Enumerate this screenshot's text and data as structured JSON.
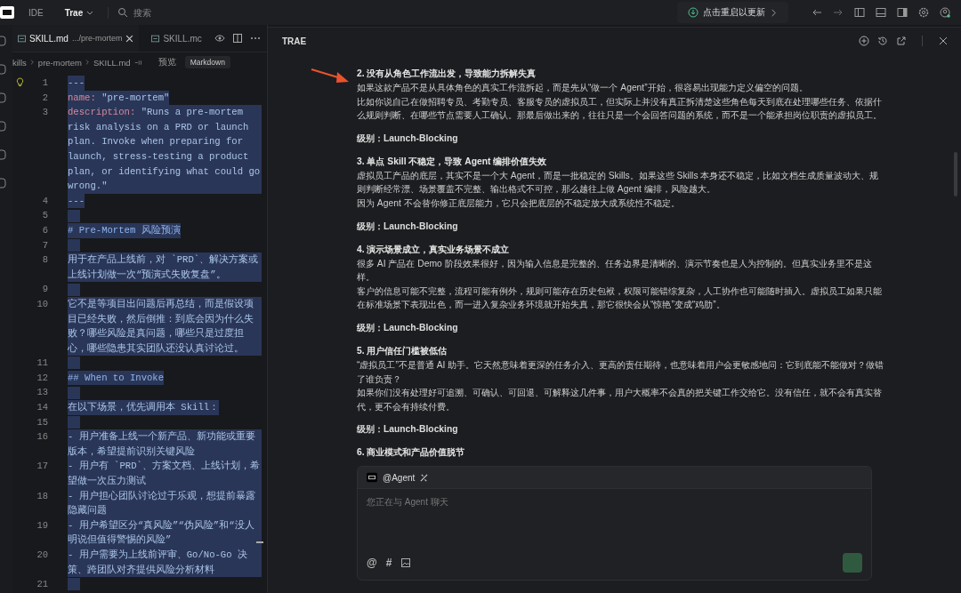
{
  "topbar": {
    "tabs": [
      {
        "label": "IDE",
        "selected": false
      },
      {
        "label": "Trae",
        "selected": true
      }
    ],
    "search": {
      "placeholder": "搜索"
    },
    "update_button": "点击重启以更新"
  },
  "editor": {
    "tabs": [
      {
        "file": "SKILL.md",
        "path": ".../pre-mortem",
        "selected": true
      },
      {
        "file": "SKILL.mc",
        "selected": false
      }
    ],
    "breadcrumb": [
      "kills",
      "pre-mortem",
      "SKILL.md"
    ],
    "preview_button": "预览",
    "language": "Markdown",
    "lines": [
      {
        "number": "1",
        "kind": "plain",
        "text": "---"
      },
      {
        "number": "2",
        "kind": "yaml",
        "key": "name:",
        "text": "\"pre-mortem\""
      },
      {
        "number": "3",
        "kind": "yaml",
        "key": "description:",
        "text": "\"Runs a pre-mortem risk analysis on a PRD or launch plan. Invoke when preparing for launch, stress-testing a product plan, or identifying what could go wrong.\""
      },
      {
        "number": "4",
        "kind": "plain",
        "text": "---"
      },
      {
        "number": "5",
        "kind": "blank"
      },
      {
        "number": "6",
        "kind": "heading",
        "text": "# Pre-Mortem 风险预演"
      },
      {
        "number": "7",
        "kind": "blank"
      },
      {
        "number": "8",
        "kind": "plain",
        "text": "用于在产品上线前，对 `PRD`、解决方案或上线计划做一次“预演式失败复盘”。"
      },
      {
        "number": "9",
        "kind": "blank"
      },
      {
        "number": "10",
        "kind": "plain",
        "text": "它不是等项目出问题后再总结，而是假设项目已经失败，然后倒推：到底会因为什么失败？哪些风险是真问题，哪些只是过度担心，哪些隐患其实团队还没认真讨论过。"
      },
      {
        "number": "11",
        "kind": "blank"
      },
      {
        "number": "12",
        "kind": "heading",
        "text": "## When to Invoke"
      },
      {
        "number": "13",
        "kind": "blank"
      },
      {
        "number": "14",
        "kind": "plain",
        "text": "在以下场景，优先调用本 Skill："
      },
      {
        "number": "15",
        "kind": "blank"
      },
      {
        "number": "16",
        "kind": "plain",
        "text": "- 用户准备上线一个新产品、新功能或重要版本，希望提前识别关键风险"
      },
      {
        "number": "17",
        "kind": "plain",
        "text": "- 用户有 `PRD`、方案文档、上线计划，希望做一次压力测试"
      },
      {
        "number": "18",
        "kind": "plain",
        "text": "- 用户担心团队讨论过于乐观，想提前暴露隐藏问题"
      },
      {
        "number": "19",
        "kind": "plain",
        "text": "- 用户希望区分“真风险”“伪风险”和“没人明说但值得警惕的风险”"
      },
      {
        "number": "20",
        "kind": "plain",
        "text": "- 用户需要为上线前评审、Go/No-Go 决策、跨团队对齐提供风险分析材料"
      },
      {
        "number": "21",
        "kind": "blank"
      }
    ]
  },
  "panel": {
    "title": "TRAE",
    "sections": [
      {
        "title": "2. 没有从角色工作流出发，导致能力拆解失真",
        "paragraphs": [
          "如果这款产品不是从具体角色的真实工作流拆起，而是先从“做一个 Agent”开始，很容易出现能力定义偏空的问题。",
          "比如你说自己在做招聘专员、考勤专员、客服专员的虚拟员工，但实际上并没有真正拆清楚这些角色每天到底在处理哪些任务、依据什么规则判断、在哪些节点需要人工确认。那最后做出来的，往往只是一个会回答问题的系统，而不是一个能承担岗位职责的虚拟员工。"
        ],
        "level": "级别：Launch-Blocking"
      },
      {
        "title": "3. 单点 Skill 不稳定，导致 Agent 编排价值失效",
        "paragraphs": [
          "虚拟员工产品的底层，其实不是一个大 Agent，而是一批稳定的 Skills。如果这些 Skills 本身还不稳定，比如文档生成质量波动大、规则判断经常漂、场景覆盖不完整、输出格式不可控，那么越往上做 Agent 编排，风险越大。",
          "因为 Agent 不会替你修正底层能力，它只会把底层的不稳定放大成系统性不稳定。"
        ],
        "level": "级别：Launch-Blocking"
      },
      {
        "title": "4. 演示场景成立，真实业务场景不成立",
        "paragraphs": [
          "很多 AI 产品在 Demo 阶段效果很好，因为输入信息是完整的、任务边界是清晰的、演示节奏也是人为控制的。但真实业务里不是这样。",
          "客户的信息可能不完整，流程可能有例外，规则可能存在历史包袱，权限可能错综复杂，人工协作也可能随时插入。虚拟员工如果只能在标准场景下表现出色，而一进入复杂业务环境就开始失真，那它很快会从“惊艳”变成“鸡肋”。"
        ],
        "level": "级别：Launch-Blocking"
      },
      {
        "title": "5. 用户信任门槛被低估",
        "paragraphs": [
          "“虚拟员工”不是普通 AI 助手。它天然意味着更深的任务介入、更高的责任期待，也意味着用户会更敏感地问：它到底能不能做对？做错了谁负责？",
          "如果你们没有处理好可追溯、可确认、可回退、可解释这几件事，用户大概率不会真的把关键工作交给它。没有信任，就不会有真实替代，更不会有持续付费。"
        ],
        "level": "级别：Launch-Blocking"
      },
      {
        "title": "6. 商业模式和产品价值脱节"
      }
    ],
    "chat": {
      "agent": "@Agent",
      "placeholder": "您正在与 Agent 聊天",
      "tools": [
        "@",
        "#"
      ]
    }
  }
}
